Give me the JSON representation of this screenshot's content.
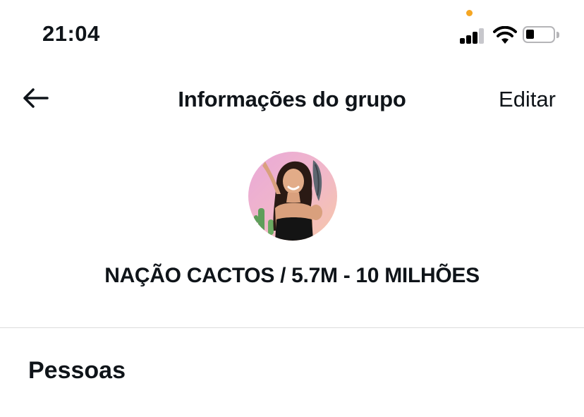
{
  "status_bar": {
    "time": "21:04",
    "icons": [
      "signal-icon",
      "wifi-icon",
      "battery-icon"
    ],
    "privacy_indicator_color": "#f5a623"
  },
  "nav": {
    "back_icon": "arrow-left-icon",
    "title": "Informações do grupo",
    "edit_label": "Editar"
  },
  "group": {
    "avatar": "group-avatar",
    "name": "NAÇÃO CACTOS / 5.7M - 10 MILHÕES"
  },
  "sections": {
    "people_title": "Pessoas"
  }
}
